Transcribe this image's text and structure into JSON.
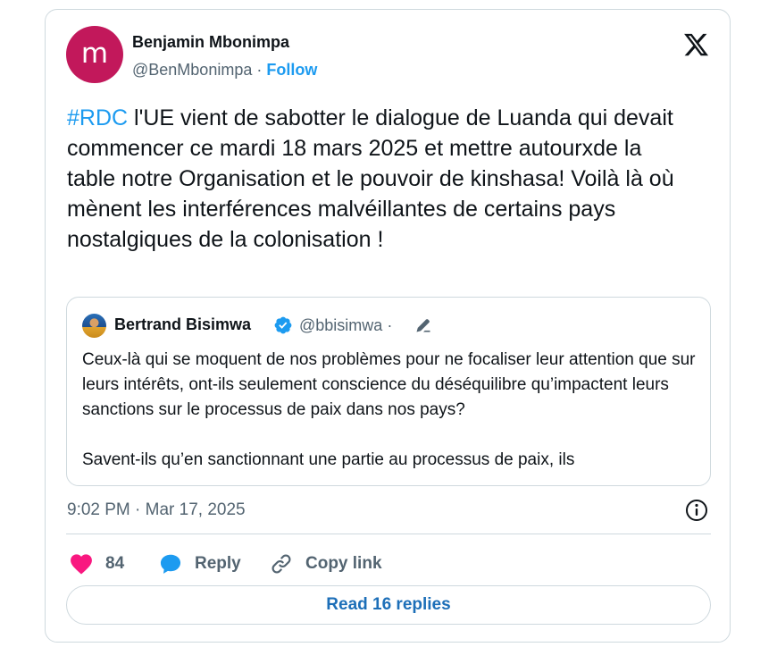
{
  "author": {
    "avatar_letter": "m",
    "avatar_color": "#c2185b",
    "name": "Benjamin Mbonimpa",
    "handle": "@BenMbonimpa",
    "separator": "·",
    "follow_label": "Follow"
  },
  "logo_icon": "x-logo-icon",
  "tweet": {
    "hashtag": "#RDC",
    "text": " l'UE vient de sabotter le dialogue de Luanda qui devait commencer ce mardi 18 mars 2025 et mettre autourxde la table notre Organisation et le pouvoir de kinshasa! Voilà là où mènent les interférences malvéillantes de certains pays nostalgiques de la colonisation !"
  },
  "quoted": {
    "name": "Bertrand Bisimwa",
    "handle": "@bbisimwa",
    "separator": "·",
    "verified_icon": "verified-badge-icon",
    "edit_icon": "pen-icon",
    "paragraph1": "Ceux-là qui se moquent de nos problèmes pour ne focaliser leur attention que sur leurs intérêts, ont-ils seulement conscience du déséquilibre qu’impactent leurs sanctions sur le processus de paix dans nos pays?",
    "paragraph2": "Savent-ils qu’en sanctionnant une partie au processus de paix, ils"
  },
  "timestamp": "9:02 PM · Mar 17, 2025",
  "actions": {
    "like_count": "84",
    "reply_label": "Reply",
    "copy_label": "Copy link"
  },
  "read_replies_label": "Read 16 replies",
  "colors": {
    "accent": "#1d9bf0",
    "like": "#f91880",
    "border": "#cfd9de",
    "muted": "#536471"
  }
}
